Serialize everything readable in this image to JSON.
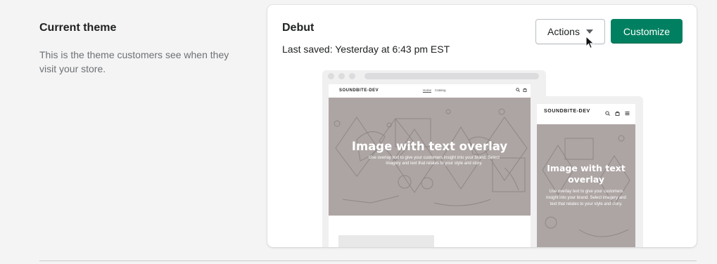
{
  "section": {
    "title": "Current theme",
    "description": "This is the theme customers see when they visit your store."
  },
  "theme": {
    "name": "Debut",
    "last_saved": "Last saved: Yesterday at 6:43 pm EST"
  },
  "buttons": {
    "actions_label": "Actions",
    "customize_label": "Customize"
  },
  "preview": {
    "store_name": "SOUNDBITE-DEV",
    "nav_links": [
      "Home",
      "Catalog"
    ],
    "hero_title": "Image with text overlay",
    "hero_subtitle": "Use overlay text to give your customers insight into your brand. Select imagery and text that relates to your style and story."
  },
  "colors": {
    "primary": "#008060",
    "hero_bg": "#ada5a4",
    "page_bg": "#f4f4f4"
  },
  "icons": [
    "search-icon",
    "cart-icon",
    "menu-icon",
    "caret-down-icon",
    "cursor-icon"
  ]
}
